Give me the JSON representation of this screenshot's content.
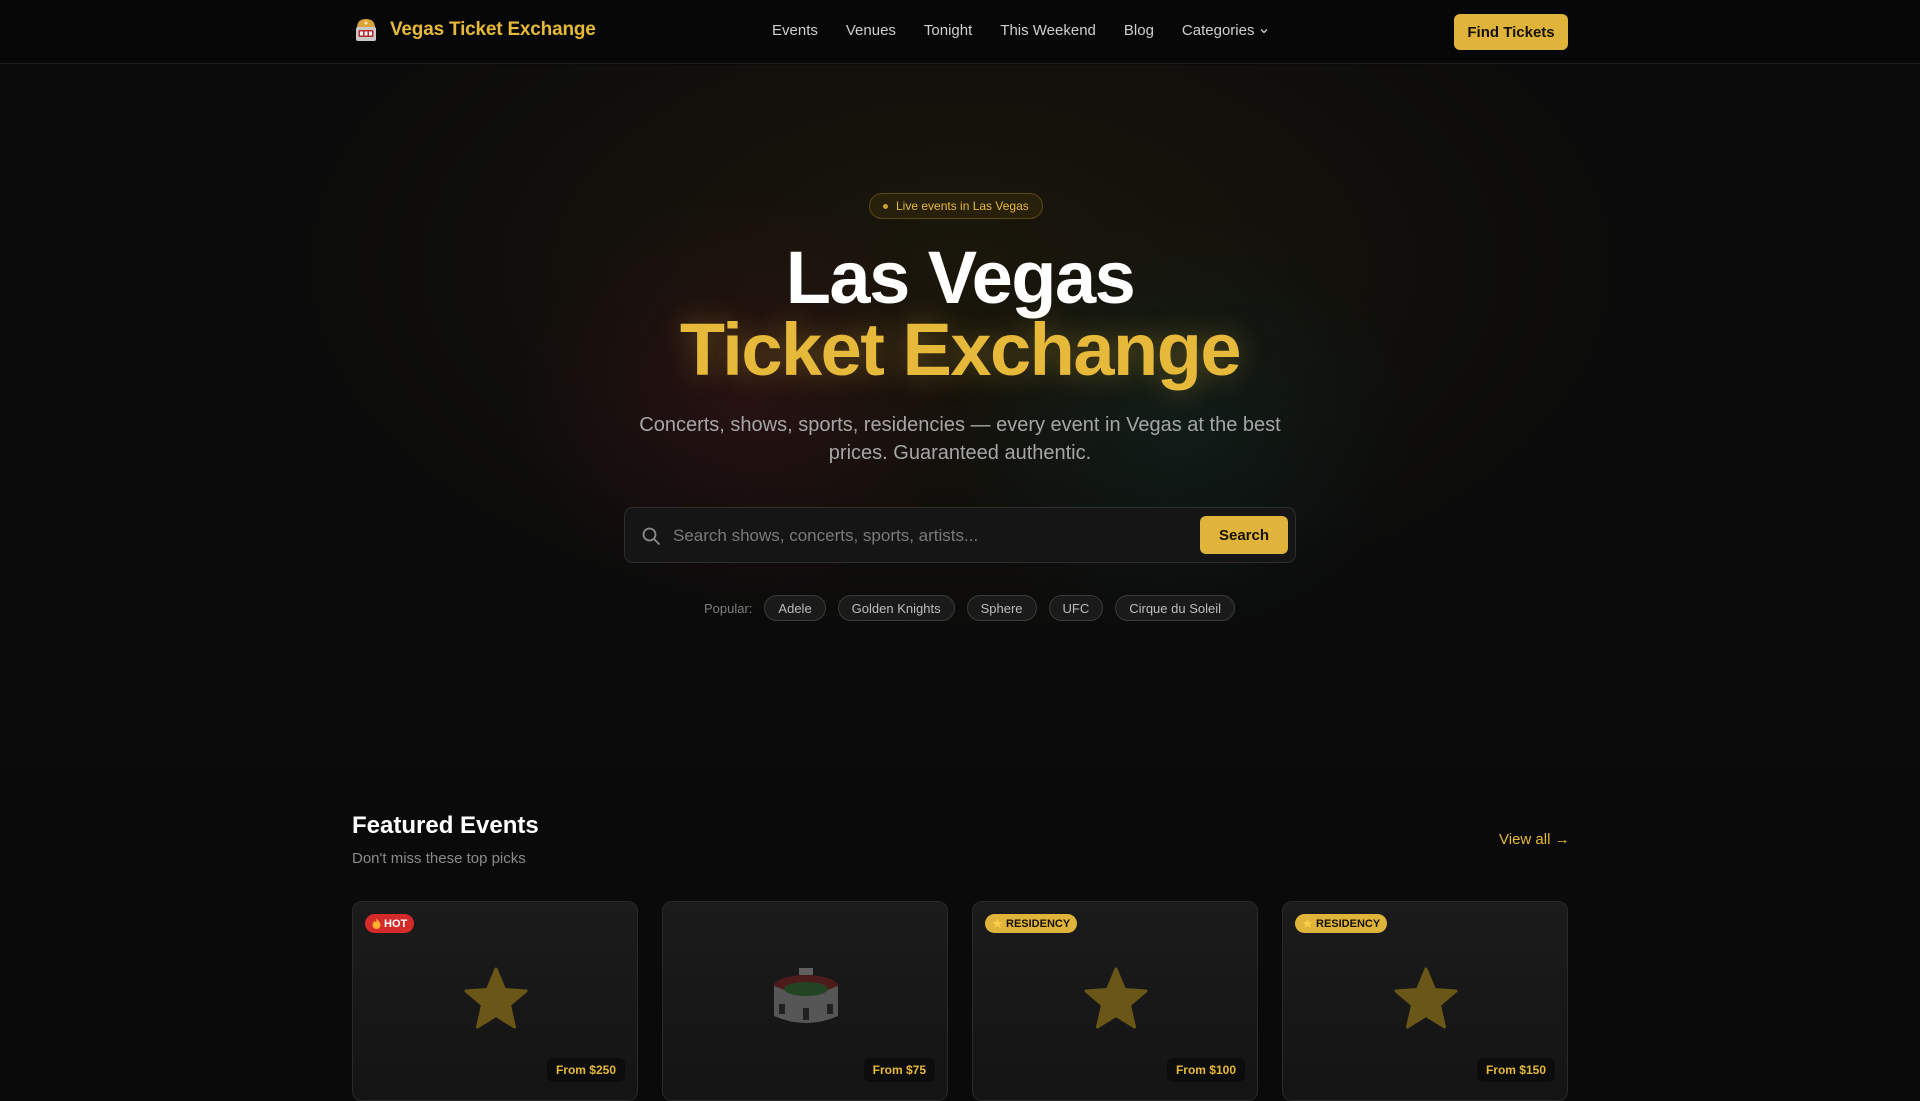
{
  "nav": {
    "brand": "Vegas Ticket Exchange",
    "links": [
      "Events",
      "Venues",
      "Tonight",
      "This Weekend",
      "Blog",
      "Categories"
    ],
    "cta": "Find Tickets"
  },
  "hero": {
    "pill": "Live events in Las Vegas",
    "title_line1": "Las Vegas",
    "title_line2": "Ticket Exchange",
    "subtitle": "Concerts, shows, sports, residencies — every event in Vegas at the best prices. Guaranteed authentic.",
    "search_placeholder": "Search shows, concerts, sports, artists...",
    "search_button": "Search",
    "popular_label": "Popular:",
    "popular_tags": [
      "Adele",
      "Golden Knights",
      "Sphere",
      "UFC",
      "Cirque du Soleil"
    ]
  },
  "featured": {
    "title": "Featured Events",
    "subtitle": "Don't miss these top picks",
    "view_all": "View all →",
    "cards": [
      {
        "badge": "HOT",
        "badge_icon": "fire-icon",
        "icon": "star-icon",
        "price": "From $250"
      },
      {
        "badge": "",
        "badge_icon": "",
        "icon": "stadium-icon",
        "price": "From $75"
      },
      {
        "badge": "RESIDENCY",
        "badge_icon": "star-icon",
        "icon": "star-icon",
        "price": "From $100"
      },
      {
        "badge": "RESIDENCY",
        "badge_icon": "star-icon",
        "icon": "star-icon",
        "price": "From $150"
      }
    ]
  },
  "colors": {
    "accent": "#e0b43a",
    "hot": "#d42a2a",
    "background": "#0a0a0a"
  }
}
